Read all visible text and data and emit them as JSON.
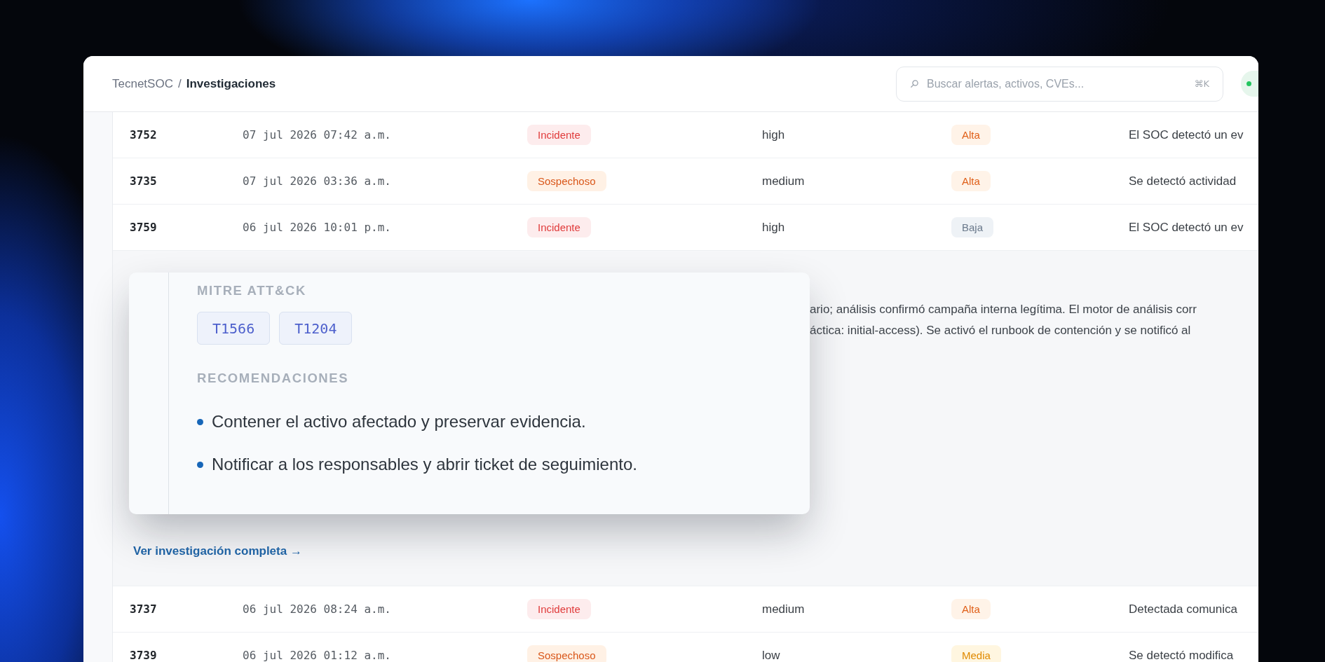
{
  "breadcrumb": {
    "root": "TecnetSOC",
    "separator": "/",
    "current": "Investigaciones"
  },
  "search": {
    "placeholder": "Buscar alertas, activos, CVEs...",
    "shortcut": "⌘K"
  },
  "status_pill": {
    "online": true
  },
  "investigations": [
    {
      "id": "3752",
      "date": "07 jul 2026 07:42 a.m.",
      "classification": {
        "label": "Incidente",
        "kind": "incident"
      },
      "severity": "high",
      "priority": {
        "label": "Alta",
        "kind": "high"
      },
      "summary": "El SOC detectó un ev"
    },
    {
      "id": "3735",
      "date": "07 jul 2026 03:36 a.m.",
      "classification": {
        "label": "Sospechoso",
        "kind": "suspicious"
      },
      "severity": "medium",
      "priority": {
        "label": "Alta",
        "kind": "high"
      },
      "summary": "Se detectó actividad"
    },
    {
      "id": "3759",
      "date": "06 jul 2026 10:01 p.m.",
      "classification": {
        "label": "Incidente",
        "kind": "incident"
      },
      "severity": "high",
      "priority": {
        "label": "Baja",
        "kind": "low"
      },
      "summary": "El SOC detectó un ev",
      "detail": {
        "text_lines": [
          "ario; análisis confirmó campaña interna legítima. El motor de análisis corr",
          "áctica: initial-access). Se activó el runbook de contención y se notificó al"
        ],
        "mitre_heading": "MITRE ATT&CK",
        "techniques": [
          "T1566",
          "T1204"
        ],
        "recommendations_heading": "RECOMENDACIONES",
        "recommendations": [
          "Contener el activo afectado y preservar evidencia.",
          "Notificar a los responsables y abrir ticket de seguimiento."
        ],
        "link": "Ver investigación completa →"
      }
    },
    {
      "id": "3737",
      "date": "06 jul 2026 08:24 a.m.",
      "classification": {
        "label": "Incidente",
        "kind": "incident"
      },
      "severity": "medium",
      "priority": {
        "label": "Alta",
        "kind": "high"
      },
      "summary": "Detectada comunica"
    },
    {
      "id": "3739",
      "date": "06 jul 2026 01:12 a.m.",
      "classification": {
        "label": "Sospechoso",
        "kind": "suspicious"
      },
      "severity": "low",
      "priority": {
        "label": "Media",
        "kind": "medium"
      },
      "summary": "Se detectó modifica"
    }
  ]
}
